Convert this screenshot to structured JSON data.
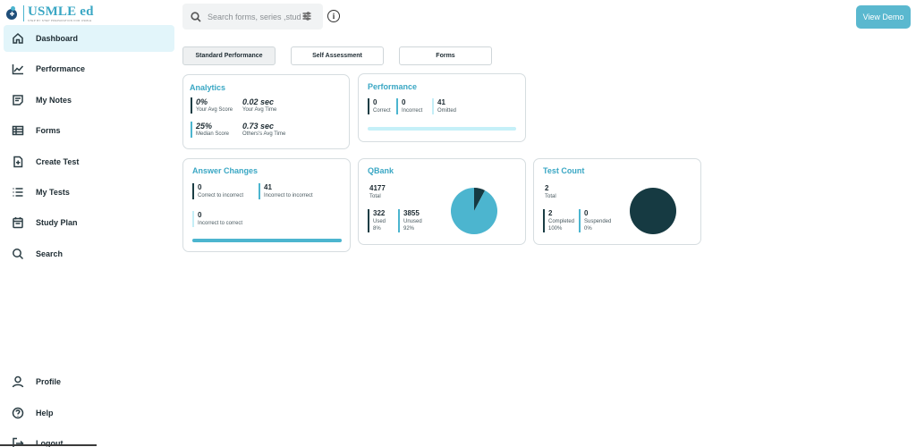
{
  "logo": {
    "name": "USMLE ed",
    "tagline": "STEP BY STEP PREPARATION FOR USMLE"
  },
  "sidebar": {
    "items": [
      {
        "label": "Dashboard",
        "icon": "home-icon",
        "active": true
      },
      {
        "label": "Performance",
        "icon": "chart-line-icon"
      },
      {
        "label": "My Notes",
        "icon": "notes-icon"
      },
      {
        "label": "Forms",
        "icon": "forms-icon"
      },
      {
        "label": "Create Test",
        "icon": "create-test-icon"
      },
      {
        "label": "My Tests",
        "icon": "list-icon"
      },
      {
        "label": "Study Plan",
        "icon": "calendar-icon"
      },
      {
        "label": "Search",
        "icon": "search-icon"
      }
    ],
    "bottom": [
      {
        "label": "Profile",
        "icon": "user-icon"
      },
      {
        "label": "Help",
        "icon": "help-icon"
      },
      {
        "label": "Logout",
        "icon": "logout-icon"
      }
    ]
  },
  "header": {
    "search_placeholder": "Search forms, series ,students",
    "view_demo": "View Demo"
  },
  "tabs": [
    {
      "label": "Standard Performance",
      "active": true
    },
    {
      "label": "Self Assessment"
    },
    {
      "label": "Forms"
    }
  ],
  "analytics": {
    "title": "Analytics",
    "avg_score": {
      "value": "0%",
      "label": "Your Avg Score"
    },
    "avg_time": {
      "value": "0.02 sec",
      "label": "Your Avg Time"
    },
    "median_score": {
      "value": "25%",
      "label": "Median Score"
    },
    "others_time": {
      "value": "0.73 sec",
      "label": "Others's Avg Time"
    }
  },
  "performance": {
    "title": "Performance",
    "correct": {
      "value": "0",
      "label": "Correct"
    },
    "incorrect": {
      "value": "0",
      "label": "Incorrect"
    },
    "omitted": {
      "value": "41",
      "label": "Omitted"
    },
    "progress": 0
  },
  "answer_changes": {
    "title": "Answer Changes",
    "c2i": {
      "value": "0",
      "label": "Correct to incorrect"
    },
    "i2i": {
      "value": "41",
      "label": "Incorrect to incorrect"
    },
    "i2c": {
      "value": "0",
      "label": "Incorrect to correct"
    },
    "progress": 1
  },
  "qbank": {
    "title": "QBank",
    "total": {
      "value": "4177",
      "label": "Total"
    },
    "used": {
      "value": "322",
      "label": "Used",
      "pct": "8%"
    },
    "unused": {
      "value": "3855",
      "label": "Unused",
      "pct": "92%"
    }
  },
  "test_count": {
    "title": "Test Count",
    "total": {
      "value": "2",
      "label": "Total"
    },
    "completed": {
      "value": "2",
      "label": "Completed",
      "pct": "100%"
    },
    "suspended": {
      "value": "0",
      "label": "Suspended",
      "pct": "0%"
    }
  },
  "colors": {
    "accent": "#4cb5cf",
    "dark": "#163a42",
    "pale": "#c5f0f8",
    "title": "#3aa7c4"
  },
  "chart_data": [
    {
      "type": "pie",
      "categories": [
        "Used",
        "Unused"
      ],
      "values": [
        322,
        3855
      ],
      "colors": [
        "#163a42",
        "#4cb5cf"
      ]
    },
    {
      "type": "pie",
      "categories": [
        "Completed",
        "Suspended"
      ],
      "values": [
        2,
        0
      ],
      "colors": [
        "#163a42",
        "#4cb5cf"
      ]
    }
  ]
}
